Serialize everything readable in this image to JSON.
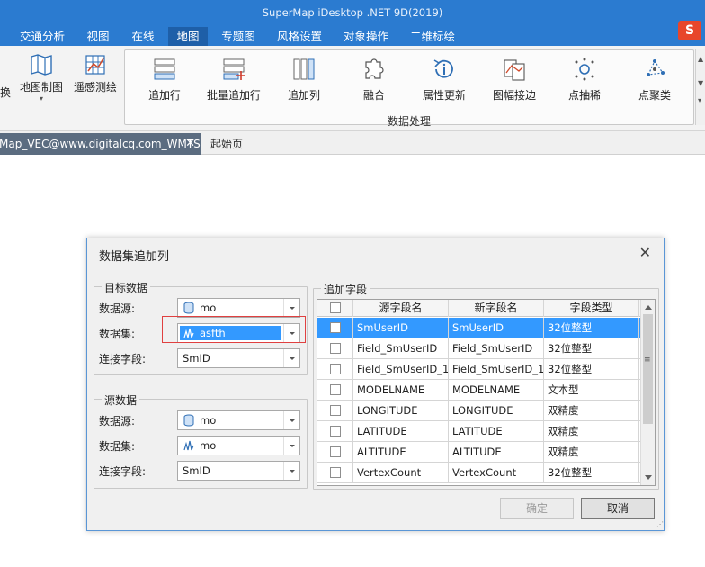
{
  "window": {
    "title": "SuperMap iDesktop .NET 9D(2019)"
  },
  "ribbon_tabs": [
    "交通分析",
    "视图",
    "在线",
    "地图",
    "专题图",
    "风格设置",
    "对象操作",
    "二维标绘"
  ],
  "brand_logo": "S",
  "ribbon": {
    "left_partial": {
      "cut_label": "换",
      "map_tool": "地图制图",
      "remote": "遥感测绘"
    },
    "group_label": "数据处理",
    "buttons": [
      "追加行",
      "批量追加行",
      "追加列",
      "融合",
      "属性更新",
      "图幅接边",
      "点抽稀",
      "点聚类"
    ]
  },
  "doc_tabs": {
    "active": "Map_VEC@www.digitalcq.com_WMTS",
    "other": "起始页",
    "close": "✕"
  },
  "dialog": {
    "title": "数据集追加列",
    "close": "✕",
    "target": {
      "legend": "目标数据",
      "datasource_label": "数据源:",
      "datasource_value": "mo",
      "dataset_label": "数据集:",
      "dataset_value": "asfth",
      "joinfield_label": "连接字段:",
      "joinfield_value": "SmID"
    },
    "source": {
      "legend": "源数据",
      "datasource_label": "数据源:",
      "datasource_value": "mo",
      "dataset_label": "数据集:",
      "dataset_value": "mo",
      "joinfield_label": "连接字段:",
      "joinfield_value": "SmID"
    },
    "append_fields": {
      "legend": "追加字段",
      "columns": [
        "源字段名",
        "新字段名",
        "字段类型"
      ],
      "rows": [
        [
          "SmUserID",
          "SmUserID",
          "32位整型"
        ],
        [
          "Field_SmUserID",
          "Field_SmUserID",
          "32位整型"
        ],
        [
          "Field_SmUserID_1",
          "Field_SmUserID_1",
          "32位整型"
        ],
        [
          "MODELNAME",
          "MODELNAME",
          "文本型"
        ],
        [
          "LONGITUDE",
          "LONGITUDE",
          "双精度"
        ],
        [
          "LATITUDE",
          "LATITUDE",
          "双精度"
        ],
        [
          "ALTITUDE",
          "ALTITUDE",
          "双精度"
        ],
        [
          "VertexCount",
          "VertexCount",
          "32位整型"
        ]
      ],
      "selected_row": 0
    },
    "ok_label": "确定",
    "cancel_label": "取消"
  },
  "colors": {
    "accent": "#2b7bd0",
    "selection": "#3399ff",
    "highlight_box": "#e04040"
  }
}
